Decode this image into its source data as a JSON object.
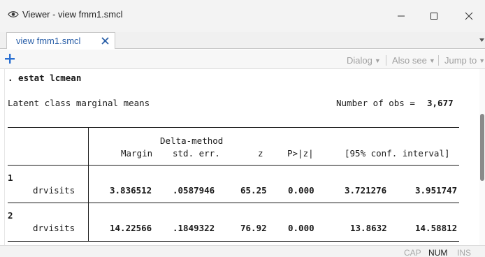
{
  "window": {
    "title": "Viewer - view fmm1.smcl",
    "icon": "eye-icon"
  },
  "tab": {
    "label": "view fmm1.smcl",
    "close_icon": "close-icon"
  },
  "toolbar": {
    "add_icon": "plus-icon",
    "dialog": "Dialog",
    "also_see": "Also see",
    "jump_to": "Jump to"
  },
  "output": {
    "command": ". estat lcmean",
    "heading": "Latent class marginal means",
    "obs_label": "Number of obs =",
    "obs_value": "3,677",
    "header": {
      "delta": "Delta-method",
      "margin": "Margin",
      "std_err": "std. err.",
      "z": "z",
      "p": "P>|z|",
      "ci": "[95% conf. interval]"
    },
    "classes": [
      {
        "class": "1",
        "var": "drvisits",
        "margin": "3.836512",
        "se": ".0587946",
        "z": "65.25",
        "p": "0.000",
        "ci_low": "3.721276",
        "ci_high": "3.951747"
      },
      {
        "class": "2",
        "var": "drvisits",
        "margin": "14.22566",
        "se": ".1849322",
        "z": "76.92",
        "p": "0.000",
        "ci_low": "13.8632",
        "ci_high": "14.58812"
      }
    ]
  },
  "statusbar": {
    "cap": "CAP",
    "num": "NUM",
    "ins": "INS"
  },
  "colors": {
    "accent": "#2a5fa8",
    "disabled": "#a0a0a0"
  }
}
